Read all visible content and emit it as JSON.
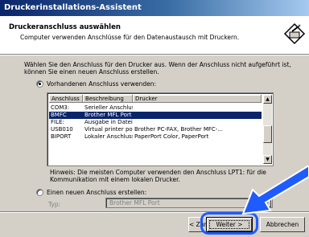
{
  "window": {
    "title": "Druckerinstallations-Assistent"
  },
  "header": {
    "title": "Druckeranschluss auswählen",
    "subtitle": "Computer verwenden Anschlüsse für den Datenaustausch mit Druckern.",
    "icon": "printer-pencil-icon"
  },
  "intro": "Wählen Sie den Anschluss für den Drucker aus. Wenn der Anschluss nicht aufgeführt ist, können Sie einen neuen Anschluss erstellen.",
  "existing_port": {
    "label": "Vorhandenen Anschluss verwenden:",
    "checked": true,
    "columns": [
      "Anschluss",
      "Beschreibung",
      "Drucker"
    ],
    "rows": [
      {
        "port": "COM3:",
        "description": "Serieller Anschluss",
        "printer": "",
        "selected": false
      },
      {
        "port": "BMFC",
        "description": "Brother MFL Port",
        "printer": "",
        "selected": true
      },
      {
        "port": "FILE:",
        "description": "Ausgabe in Datei",
        "printer": "",
        "selected": false
      },
      {
        "port": "USB010",
        "description": "Virtual printer port for ...",
        "printer": "Brother PC-FAX, Brother MFC-...",
        "selected": false
      },
      {
        "port": "BIPORT",
        "description": "Lokaler Anschluss",
        "printer": "PaperPort Color, PaperPort",
        "selected": false
      }
    ]
  },
  "hint": "Hinweis: Die meisten Computer verwenden den Anschluss LPT1: für die Kommunikation mit einem lokalen Drucker.",
  "new_port": {
    "label": "Einen neuen Anschluss erstellen:",
    "checked": false,
    "type_label": "Typ:",
    "type_value": "Brother MFL Port"
  },
  "buttons": {
    "back": "< Zurück",
    "next": "Weiter >",
    "cancel": "Abbrechen"
  },
  "colors": {
    "title_gradient_start": "#0a246a",
    "selection": "#0a246a",
    "highlight": "#1e5cff"
  }
}
